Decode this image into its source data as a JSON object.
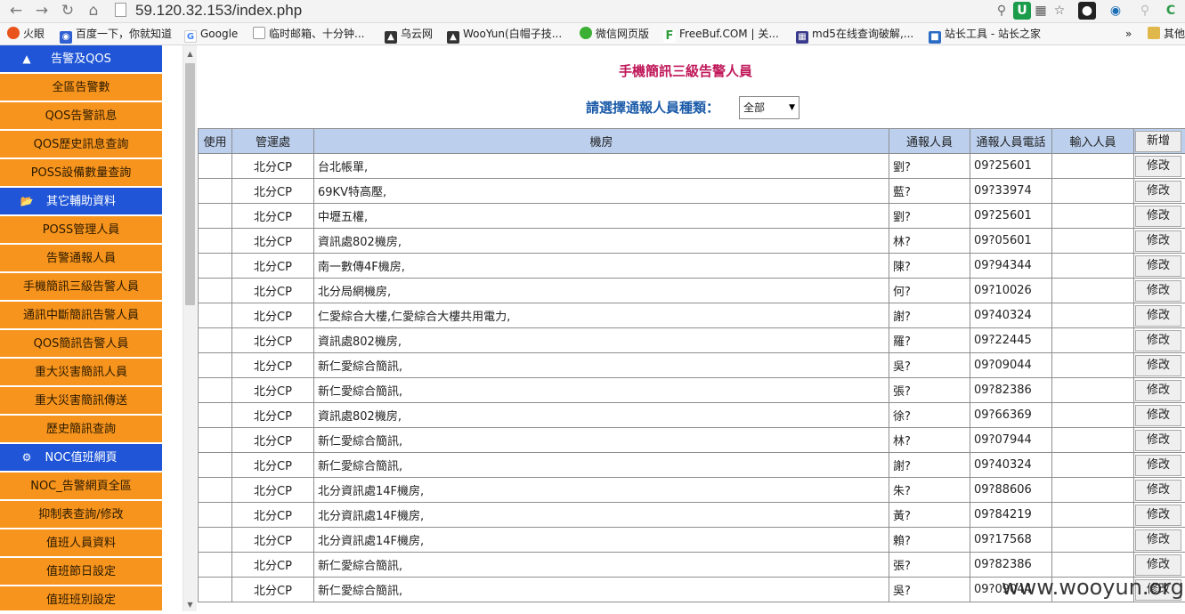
{
  "browser": {
    "url": "59.120.32.153/index.php",
    "bookmarks": [
      {
        "label": "火眼",
        "icon": "firefox-icon",
        "color": "#e8541c"
      },
      {
        "label": "百度一下，你就知道",
        "icon": "baidu-paw-icon",
        "color": "#2f5fd0"
      },
      {
        "label": "Google",
        "icon": "google-icon",
        "color": "#4285f4"
      },
      {
        "label": "临时邮箱、十分钟...",
        "icon": "page-icon",
        "color": "#999999"
      },
      {
        "label": "乌云网",
        "icon": "wooyun-icon",
        "color": "#333333"
      },
      {
        "label": "WooYun(白帽子技...",
        "icon": "wooyun-icon",
        "color": "#333333"
      },
      {
        "label": "微信网页版",
        "icon": "wechat-icon",
        "color": "#3cb034"
      },
      {
        "label": "FreeBuf.COM | 关...",
        "icon": "freebuf-icon",
        "color": "#2e9c3b"
      },
      {
        "label": "md5在线查询破解,...",
        "icon": "grid-icon",
        "color": "#3a3a8c"
      },
      {
        "label": "站长工具 - 站长之家",
        "icon": "chinaz-icon",
        "color": "#2a6cc4"
      },
      {
        "label": "»",
        "icon": "",
        "color": ""
      },
      {
        "label": "其他",
        "icon": "folder-icon",
        "color": "#e0b74a"
      }
    ]
  },
  "sidebar": {
    "items": [
      {
        "label": "告警及QOS",
        "type": "header",
        "icon": "warning-icon"
      },
      {
        "label": "全區告警數",
        "type": "link"
      },
      {
        "label": "QOS告警訊息",
        "type": "link"
      },
      {
        "label": "QOS歷史訊息查詢",
        "type": "link"
      },
      {
        "label": "POSS設備數量查詢",
        "type": "link"
      },
      {
        "label": "其它輔助資料",
        "type": "header",
        "icon": "folder-open-icon"
      },
      {
        "label": "POSS管理人員",
        "type": "link"
      },
      {
        "label": "告警通報人員",
        "type": "link"
      },
      {
        "label": "手機簡訊三級告警人員",
        "type": "link"
      },
      {
        "label": "通訊中斷簡訊告警人員",
        "type": "link"
      },
      {
        "label": "QOS簡訊告警人員",
        "type": "link"
      },
      {
        "label": "重大災害簡訊人員",
        "type": "link"
      },
      {
        "label": "重大災害簡訊傳送",
        "type": "link"
      },
      {
        "label": "歷史簡訊查詢",
        "type": "link"
      },
      {
        "label": "NOC值班網頁",
        "type": "header",
        "icon": "settings-icon"
      },
      {
        "label": "NOC_告警網頁全區",
        "type": "link"
      },
      {
        "label": "抑制表查詢/修改",
        "type": "link"
      },
      {
        "label": "值班人員資料",
        "type": "link"
      },
      {
        "label": "值班節日設定",
        "type": "link"
      },
      {
        "label": "值班班別設定",
        "type": "link"
      }
    ]
  },
  "main": {
    "title": "手機簡訊三級告警人員",
    "filter": {
      "label": "請選擇通報人員種類：",
      "selected": "全部"
    },
    "columns": [
      "使用",
      "管運處",
      "機房",
      "通報人員",
      "通報人員電話",
      "輸入人員",
      "新增"
    ],
    "edit_label": "修改",
    "rows": [
      {
        "use": "",
        "loc": "北分CP",
        "room": "台北帳單,",
        "person": "劉?",
        "phone": "09?25601",
        "input": ""
      },
      {
        "use": "",
        "loc": "北分CP",
        "room": "69KV特高壓,",
        "person": "藍?",
        "phone": "09?33974",
        "input": ""
      },
      {
        "use": "",
        "loc": "北分CP",
        "room": "中壢五權,",
        "person": "劉?",
        "phone": "09?25601",
        "input": ""
      },
      {
        "use": "",
        "loc": "北分CP",
        "room": "資訊處802機房,",
        "person": "林?",
        "phone": "09?05601",
        "input": ""
      },
      {
        "use": "",
        "loc": "北分CP",
        "room": "南一數傳4F機房,",
        "person": "陳?",
        "phone": "09?94344",
        "input": ""
      },
      {
        "use": "",
        "loc": "北分CP",
        "room": "北分局網機房,",
        "person": "何?",
        "phone": "09?10026",
        "input": ""
      },
      {
        "use": "",
        "loc": "北分CP",
        "room": "仁愛綜合大樓,仁愛綜合大樓共用電力,",
        "person": "謝?",
        "phone": "09?40324",
        "input": ""
      },
      {
        "use": "",
        "loc": "北分CP",
        "room": "資訊處802機房,",
        "person": "羅?",
        "phone": "09?22445",
        "input": ""
      },
      {
        "use": "",
        "loc": "北分CP",
        "room": "新仁愛綜合簡訊,",
        "person": "吳?",
        "phone": "09?09044",
        "input": ""
      },
      {
        "use": "",
        "loc": "北分CP",
        "room": "新仁愛綜合簡訊,",
        "person": "張?",
        "phone": "09?82386",
        "input": ""
      },
      {
        "use": "",
        "loc": "北分CP",
        "room": "資訊處802機房,",
        "person": "徐?",
        "phone": "09?66369",
        "input": ""
      },
      {
        "use": "",
        "loc": "北分CP",
        "room": "新仁愛綜合簡訊,",
        "person": "林?",
        "phone": "09?07944",
        "input": ""
      },
      {
        "use": "",
        "loc": "北分CP",
        "room": "新仁愛綜合簡訊,",
        "person": "謝?",
        "phone": "09?40324",
        "input": ""
      },
      {
        "use": "",
        "loc": "北分CP",
        "room": "北分資訊處14F機房,",
        "person": "朱?",
        "phone": "09?88606",
        "input": ""
      },
      {
        "use": "",
        "loc": "北分CP",
        "room": "北分資訊處14F機房,",
        "person": "黃?",
        "phone": "09?84219",
        "input": ""
      },
      {
        "use": "",
        "loc": "北分CP",
        "room": "北分資訊處14F機房,",
        "person": "賴?",
        "phone": "09?17568",
        "input": ""
      },
      {
        "use": "",
        "loc": "北分CP",
        "room": "新仁愛綜合簡訊,",
        "person": "張?",
        "phone": "09?82386",
        "input": ""
      },
      {
        "use": "",
        "loc": "北分CP",
        "room": "新仁愛綜合簡訊,",
        "person": "吳?",
        "phone": "09?09044",
        "input": ""
      }
    ]
  },
  "watermark": "www.wooyun.org"
}
